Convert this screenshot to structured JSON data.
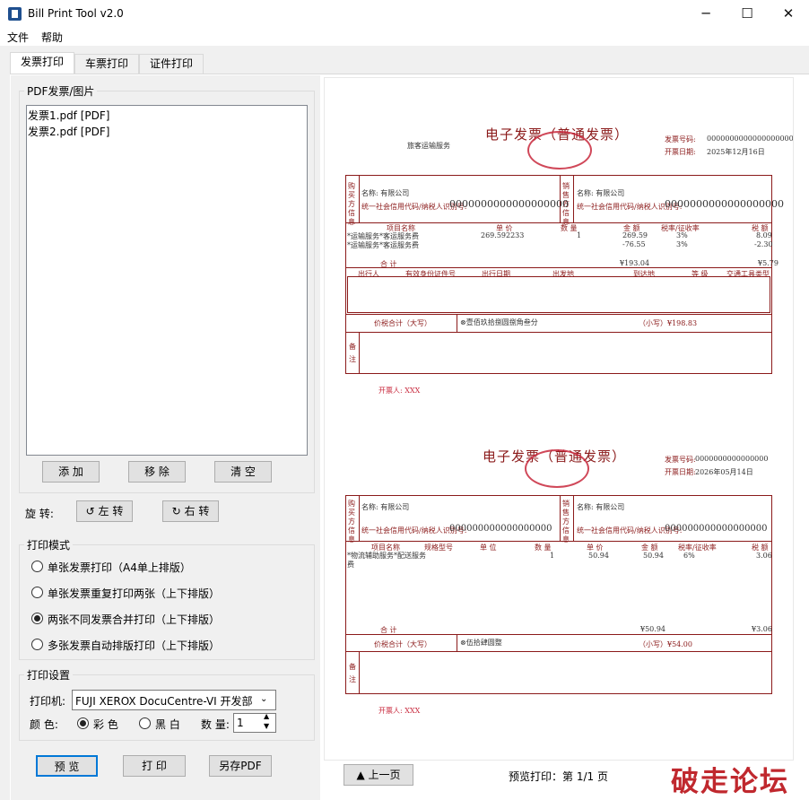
{
  "window": {
    "title": "Bill Print Tool v2.0",
    "minimize": "─",
    "maximize": "☐",
    "close": "✕"
  },
  "menu": [
    "文件",
    "帮助"
  ],
  "tabs": [
    "发票打印",
    "车票打印",
    "证件打印"
  ],
  "file_group": {
    "title": "PDF发票/图片",
    "files": [
      "发票1.pdf [PDF]",
      "发票2.pdf [PDF]"
    ],
    "add": "添 加",
    "remove": "移 除",
    "clear": "清 空"
  },
  "rotate": {
    "label": "旋 转:",
    "left": "↺ 左 转",
    "right": "↻ 右 转"
  },
  "print_mode": {
    "title": "打印模式",
    "options": [
      "单张发票打印（A4单上排版）",
      "单张发票重复打印两张（上下排版）",
      "两张不同发票合并打印（上下排版）",
      "多张发票自动排版打印（上下排版）"
    ],
    "selected": 2
  },
  "print_settings": {
    "title": "打印设置",
    "printer_label": "打印机:",
    "printer": "FUJI XEROX DocuCentre-VI 开发部",
    "color_label": "颜   色:",
    "color": "彩 色",
    "bw": "黑 白",
    "qty_label": "数 量:",
    "qty": "1"
  },
  "bottom": {
    "preview": "预 览",
    "print": "打 印",
    "save_pdf": "另存PDF",
    "prev_page": "▲ 上一页",
    "page_status": "预览打印：第 1/1 页"
  },
  "invoice1": {
    "title": "电子发票（普通发票）",
    "type": "旅客运输服务",
    "no_label": "发票号码:",
    "no": "00000000000000000000",
    "date_label": "开票日期:",
    "date": "2025年12月16日",
    "buyer": "名称: 有限公司",
    "tax_label": "统一社会信用代码/纳税人识别号:",
    "tax_no": "0000000000000000000",
    "seller": "名称: 有限公司",
    "cols": [
      "项目名称",
      "单 价",
      "数 量",
      "金 额",
      "税率/征收率",
      "税 额"
    ],
    "rows": [
      [
        "*运输服务*客运服务费",
        "269.592233",
        "1",
        "269.59",
        "3%",
        "8.09"
      ],
      [
        "*运输服务*客运服务费",
        "",
        "",
        "-76.55",
        "3%",
        "-2.30"
      ]
    ],
    "total_label": "合   计",
    "total_amount": "¥193.04",
    "total_tax": "¥5.79",
    "travel_cols": [
      "出行人",
      "有效身份证件号",
      "出行日期",
      "出发地",
      "到达地",
      "等 级",
      "交通工具类型"
    ],
    "sum_label": "价税合计（大写）",
    "sum_words": "⊗壹佰玖拾捌圆捌角叁分",
    "sum_num": "（小写）¥198.83",
    "remark": "备注",
    "issuer": "开票人:  XXX"
  },
  "invoice2": {
    "title": "电子发票（普通发票）",
    "no_label": "发票号码:",
    "no": "0000000000000000",
    "date_label": "开票日期:",
    "date": "2026年05月14日",
    "buyer": "名称: 有限公司",
    "tax_label": "统一社会信用代码/纳税人识别号:",
    "tax_no": "000000000000000000",
    "seller": "名称: 有限公司",
    "cols": [
      "项目名称",
      "规格型号",
      "单 位",
      "数 量",
      "单 价",
      "金 额",
      "税率/征收率",
      "税 额"
    ],
    "row": [
      "*物流辅助服务*配送服务费",
      "1",
      "50.94",
      "50.94",
      "6%",
      "3.06"
    ],
    "total_label": "合   计",
    "total_amount": "¥50.94",
    "total_tax": "¥3.06",
    "sum_label": "价税合计（大写）",
    "sum_words": "⊗伍拾肆圆整",
    "sum_num": "（小写）¥54.00",
    "remark": "备注",
    "issuer": "开票人:  XXX"
  },
  "watermark": "破走论坛"
}
